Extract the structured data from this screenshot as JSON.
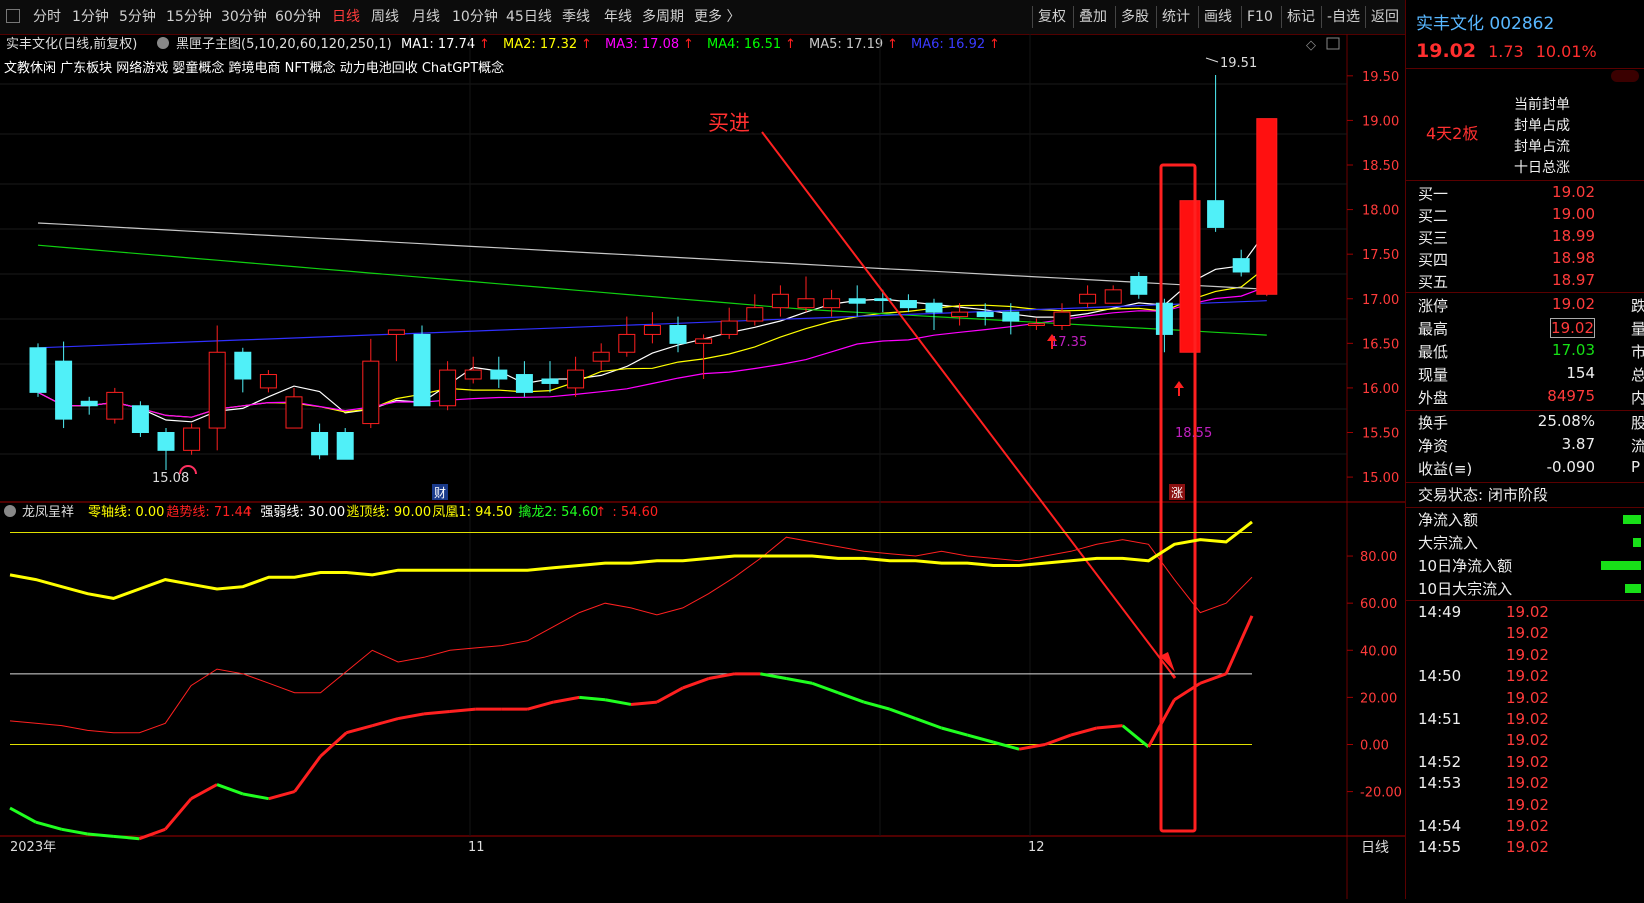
{
  "toolbar": {
    "periods": [
      "分时",
      "1分钟",
      "5分钟",
      "15分钟",
      "30分钟",
      "60分钟",
      "日线",
      "周线",
      "月线",
      "10分钟",
      "45日线",
      "季线",
      "年线",
      "多周期",
      "更多 〉"
    ],
    "active_period": "日线",
    "right_buttons": [
      "复权",
      "叠加",
      "多股",
      "统计",
      "画线",
      "F10",
      "标记",
      "-自选",
      "返回"
    ]
  },
  "chart_header": {
    "title": "实丰文化(日线,前复权)",
    "indicator_name": "黑匣子主图(5,10,20,60,120,250,1)",
    "ma": [
      {
        "label": "MA1: 17.74",
        "color": "#ffffff"
      },
      {
        "label": "MA2: 17.32",
        "color": "#ffff00"
      },
      {
        "label": "MA3: 17.08",
        "color": "#ff00ff"
      },
      {
        "label": "MA4: 16.51",
        "color": "#00ff00"
      },
      {
        "label": "MA5: 17.19",
        "color": "#c8c8c8"
      },
      {
        "label": "MA6: 16.92",
        "color": "#3a3aff"
      }
    ],
    "tags": "文教休闲 广东板块 网络游戏 婴童概念 跨境电商 NFT概念 动力电池回收 ChatGPT概念"
  },
  "annotations": {
    "buy": "买进",
    "high_label": "19.51",
    "low_label": "15.08",
    "mid_label": "17.35",
    "band_label": "18.55",
    "cai": "财",
    "zhang": "涨"
  },
  "price_axis": [
    "19.50",
    "19.00",
    "18.50",
    "18.00",
    "17.50",
    "17.00",
    "16.50",
    "16.00",
    "15.50",
    "15.00"
  ],
  "indicator_header": {
    "name": "龙凤呈祥",
    "items": [
      {
        "label": "零轴线: 0.00",
        "color": "#ffff00"
      },
      {
        "label": "趋势线: 71.44",
        "color": "#ff2020"
      },
      {
        "label": "强弱线: 30.00",
        "color": "#ffffff"
      },
      {
        "label": "逃顶线: 90.00",
        "color": "#ffff00"
      },
      {
        "label": "凤凰1: 94.50",
        "color": "#ffff00"
      },
      {
        "label": "擒龙2: 54.60",
        "color": "#20ff20"
      },
      {
        "label": ": 54.60",
        "color": "#ff2020"
      }
    ]
  },
  "indicator_axis": [
    "80.00",
    "60.00",
    "40.00",
    "20.00",
    "0.00",
    "-20.00"
  ],
  "date_axis": {
    "d1": "2023年",
    "d2": "11",
    "d3": "12",
    "period": "日线"
  },
  "chart_data": {
    "type": "candlestick",
    "title": "实丰文化(日线,前复权)",
    "ylim": [
      14.9,
      19.7
    ],
    "candles": [
      [
        16.45,
        15.95,
        16.5,
        15.9
      ],
      [
        16.3,
        15.65,
        16.52,
        15.55
      ],
      [
        15.85,
        15.8,
        15.9,
        15.7
      ],
      [
        15.65,
        15.95,
        16.0,
        15.6
      ],
      [
        15.8,
        15.5,
        15.85,
        15.45
      ],
      [
        15.5,
        15.3,
        15.55,
        15.08
      ],
      [
        15.3,
        15.55,
        15.6,
        15.25
      ],
      [
        15.55,
        16.4,
        16.7,
        15.3
      ],
      [
        16.4,
        16.1,
        16.45,
        15.95
      ],
      [
        16.0,
        16.15,
        16.2,
        15.95
      ],
      [
        15.55,
        15.9,
        16.0,
        15.55
      ],
      [
        15.5,
        15.25,
        15.6,
        15.2
      ],
      [
        15.5,
        15.2,
        15.55,
        15.2
      ],
      [
        15.6,
        16.3,
        16.55,
        15.55
      ],
      [
        16.6,
        16.65,
        16.6,
        16.3
      ],
      [
        16.6,
        15.8,
        16.7,
        15.8
      ],
      [
        15.8,
        16.2,
        16.3,
        15.75
      ],
      [
        16.1,
        16.2,
        16.35,
        16.05
      ],
      [
        16.2,
        16.1,
        16.35,
        16.0
      ],
      [
        16.15,
        15.95,
        16.3,
        15.9
      ],
      [
        16.1,
        16.05,
        16.3,
        15.95
      ],
      [
        16.0,
        16.2,
        16.35,
        15.9
      ],
      [
        16.3,
        16.4,
        16.5,
        16.2
      ],
      [
        16.4,
        16.6,
        16.8,
        16.35
      ],
      [
        16.6,
        16.7,
        16.85,
        16.5
      ],
      [
        16.7,
        16.5,
        16.8,
        16.4
      ],
      [
        16.5,
        16.55,
        16.6,
        16.1
      ],
      [
        16.6,
        16.75,
        16.9,
        16.55
      ],
      [
        16.75,
        16.9,
        17.05,
        16.7
      ],
      [
        16.9,
        17.05,
        17.15,
        16.8
      ],
      [
        16.9,
        17.0,
        17.25,
        16.85
      ],
      [
        16.9,
        17.0,
        17.1,
        16.8
      ],
      [
        17.0,
        16.95,
        17.15,
        16.8
      ],
      [
        17.0,
        16.98,
        17.1,
        16.85
      ],
      [
        16.98,
        16.9,
        17.05,
        16.85
      ],
      [
        16.95,
        16.85,
        17.0,
        16.65
      ],
      [
        16.8,
        16.85,
        16.95,
        16.7
      ],
      [
        16.85,
        16.8,
        16.95,
        16.7
      ],
      [
        16.85,
        16.75,
        16.95,
        16.6
      ],
      [
        16.7,
        16.72,
        16.78,
        16.65
      ],
      [
        16.7,
        16.85,
        16.95,
        16.65
      ],
      [
        16.95,
        17.05,
        17.15,
        16.9
      ],
      [
        16.95,
        17.1,
        17.15,
        16.95
      ],
      [
        17.25,
        17.05,
        17.3,
        17.0
      ],
      [
        16.95,
        16.6,
        17.0,
        16.4
      ],
      [
        16.4,
        18.1,
        18.1,
        16.4
      ],
      [
        18.1,
        17.8,
        19.51,
        17.75
      ],
      [
        17.45,
        17.3,
        17.55,
        17.25
      ],
      [
        17.05,
        19.02,
        19.02,
        17.03
      ]
    ],
    "indicator": {
      "zero": 0,
      "strong": 30,
      "top": 90,
      "ylim": [
        -38,
        97
      ],
      "trend": [
        10,
        9,
        8,
        6,
        5,
        5,
        9,
        25,
        32,
        30,
        26,
        22,
        22,
        31,
        40,
        35,
        37,
        40,
        41,
        42,
        44,
        50,
        56,
        60,
        58,
        55,
        58,
        64,
        71,
        79,
        88,
        86,
        84,
        82,
        81,
        80,
        82,
        80,
        79,
        78,
        80,
        82,
        85,
        87,
        85,
        70,
        56,
        60,
        71
      ],
      "yellow": [
        72,
        70,
        67,
        64,
        62,
        66,
        70,
        68,
        66,
        67,
        71,
        71,
        73,
        73,
        72,
        74,
        74,
        74,
        74,
        74,
        74,
        75,
        76,
        77,
        77,
        78,
        78,
        79,
        80,
        80,
        80,
        80,
        79,
        79,
        78,
        78,
        77,
        77,
        76,
        76,
        77,
        78,
        79,
        79,
        78,
        85,
        87,
        86,
        94.5
      ],
      "long": [
        -27,
        -33,
        -36,
        -38,
        -39,
        -40,
        -36,
        -23,
        -17,
        -21,
        -23,
        -20,
        -5,
        5,
        8,
        11,
        13,
        14,
        15,
        15,
        15,
        18,
        20,
        19,
        17,
        18,
        24,
        28,
        30,
        30,
        28,
        26,
        22,
        18,
        15,
        11,
        7,
        4,
        1,
        -2,
        0,
        4,
        7,
        8,
        -1,
        19,
        26,
        30,
        54.6
      ]
    }
  },
  "right_panel": {
    "name": "实丰文化",
    "code": "002862",
    "price": "19.02",
    "change": "1.73",
    "pct": "10.01%",
    "boards": "4天2板",
    "seal_lines": [
      "当前封单",
      "封单占成",
      "封单占流",
      "十日总涨"
    ],
    "bids": [
      {
        "label": "买一",
        "price": "19.02"
      },
      {
        "label": "买二",
        "price": "19.00"
      },
      {
        "label": "买三",
        "price": "18.99"
      },
      {
        "label": "买四",
        "price": "18.98"
      },
      {
        "label": "买五",
        "price": "18.97"
      }
    ],
    "stats": [
      {
        "label": "涨停",
        "value": "19.02",
        "tail": "跌",
        "cls": ""
      },
      {
        "label": "最高",
        "value": "19.02",
        "tail": "量",
        "cls": ""
      },
      {
        "label": "最低",
        "value": "17.03",
        "tail": "市",
        "cls": "green"
      },
      {
        "label": "现量",
        "value": "154",
        "tail": "总",
        "cls": "white"
      },
      {
        "label": "外盘",
        "value": "84975",
        "tail": "内",
        "cls": ""
      }
    ],
    "stats2": [
      {
        "label": "换手",
        "value": "25.08%",
        "tail": "股",
        "cls": "white"
      },
      {
        "label": "净资",
        "value": "3.87",
        "tail": "流",
        "cls": "white"
      },
      {
        "label": "收益(≡)",
        "value": "-0.090",
        "tail": "P",
        "cls": "white"
      }
    ],
    "trade_status": "交易状态: 闭市阶段",
    "flows": [
      "净流入额",
      "大宗流入",
      "10日净流入额",
      "10日大宗流入"
    ],
    "ticks": [
      {
        "time": "14:49",
        "price": "19.02"
      },
      {
        "time": "",
        "price": "19.02"
      },
      {
        "time": "",
        "price": "19.02"
      },
      {
        "time": "14:50",
        "price": "19.02"
      },
      {
        "time": "",
        "price": "19.02"
      },
      {
        "time": "14:51",
        "price": "19.02"
      },
      {
        "time": "",
        "price": "19.02"
      },
      {
        "time": "14:52",
        "price": "19.02"
      },
      {
        "time": "14:53",
        "price": "19.02"
      },
      {
        "time": "",
        "price": "19.02"
      },
      {
        "time": "14:54",
        "price": "19.02"
      },
      {
        "time": "14:55",
        "price": "19.02"
      }
    ]
  }
}
